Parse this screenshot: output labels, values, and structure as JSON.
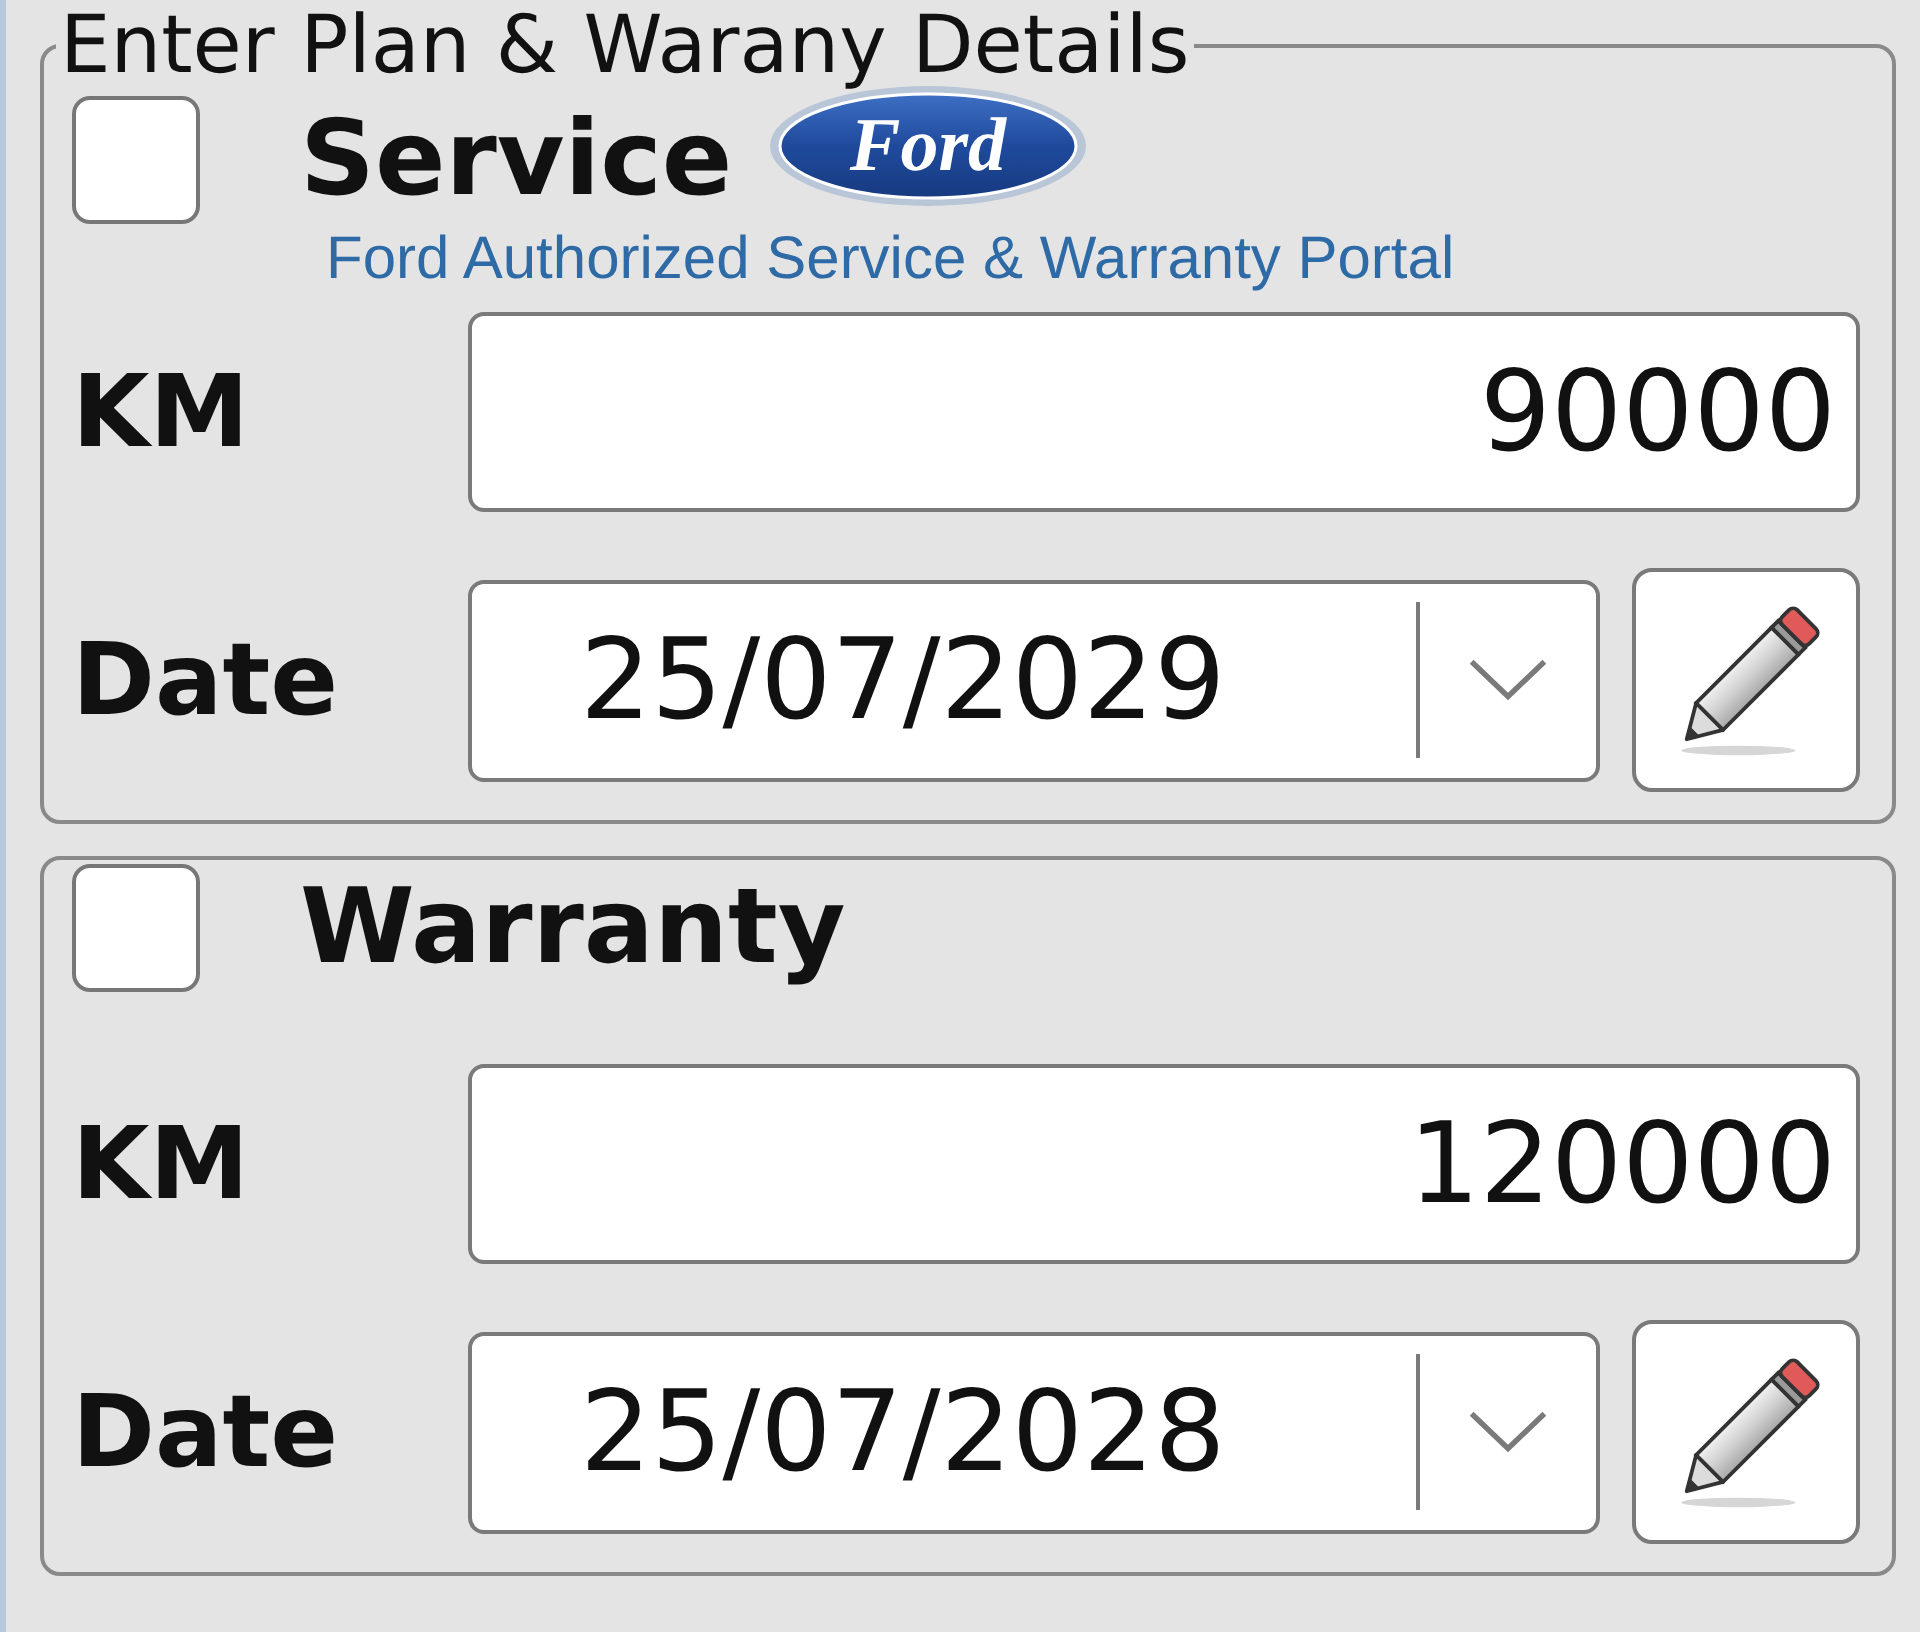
{
  "sections": [
    {
      "legend": "Enter Plan & Warany Details",
      "checked": false,
      "title": "Service",
      "logo": {
        "text": "Ford"
      },
      "subtitle": "Ford Authorized Service & Warranty Portal",
      "km": {
        "label": "KM",
        "value": "90000"
      },
      "date": {
        "label": "Date",
        "value": "25/07/2029"
      }
    },
    {
      "checked": false,
      "title": "Warranty",
      "km": {
        "label": "KM",
        "value": "120000"
      },
      "date": {
        "label": "Date",
        "value": "25/07/2028"
      }
    }
  ]
}
